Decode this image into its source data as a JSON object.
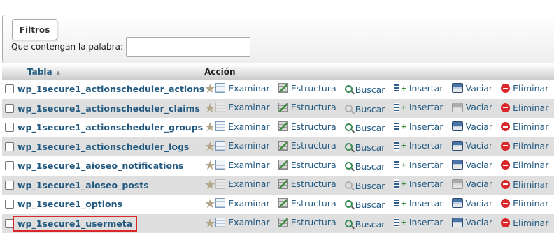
{
  "filters": {
    "legend": "Filtros",
    "label": "Que contengan la palabra:",
    "value": "",
    "placeholder": ""
  },
  "table_header": {
    "name_col": "Tabla",
    "sort_indicator": "▲",
    "action_col": "Acción"
  },
  "actions": {
    "browse": "Examinar",
    "structure": "Estructura",
    "search": "Buscar",
    "insert": "Insertar",
    "empty": "Vaciar",
    "drop": "Eliminar"
  },
  "icons": {
    "favorite": "star-icon",
    "browse": "browse-icon",
    "structure": "structure-icon",
    "search": "search-icon",
    "insert": "insert-icon",
    "empty": "empty-icon",
    "drop": "drop-icon"
  },
  "rows": [
    {
      "name": "wp_1secure1_actionscheduler_actions",
      "empty_table": false
    },
    {
      "name": "wp_1secure1_actionscheduler_claims",
      "empty_table": true
    },
    {
      "name": "wp_1secure1_actionscheduler_groups",
      "empty_table": false
    },
    {
      "name": "wp_1secure1_actionscheduler_logs",
      "empty_table": false
    },
    {
      "name": "wp_1secure1_aioseo_notifications",
      "empty_table": false
    },
    {
      "name": "wp_1secure1_aioseo_posts",
      "empty_table": true
    },
    {
      "name": "wp_1secure1_options",
      "empty_table": false
    },
    {
      "name": "wp_1secure1_usermeta",
      "empty_table": false,
      "highlighted": true
    }
  ],
  "colors": {
    "link": "#235a81",
    "row_alt": "#dfdfdf",
    "highlight_border": "#d9272b"
  }
}
